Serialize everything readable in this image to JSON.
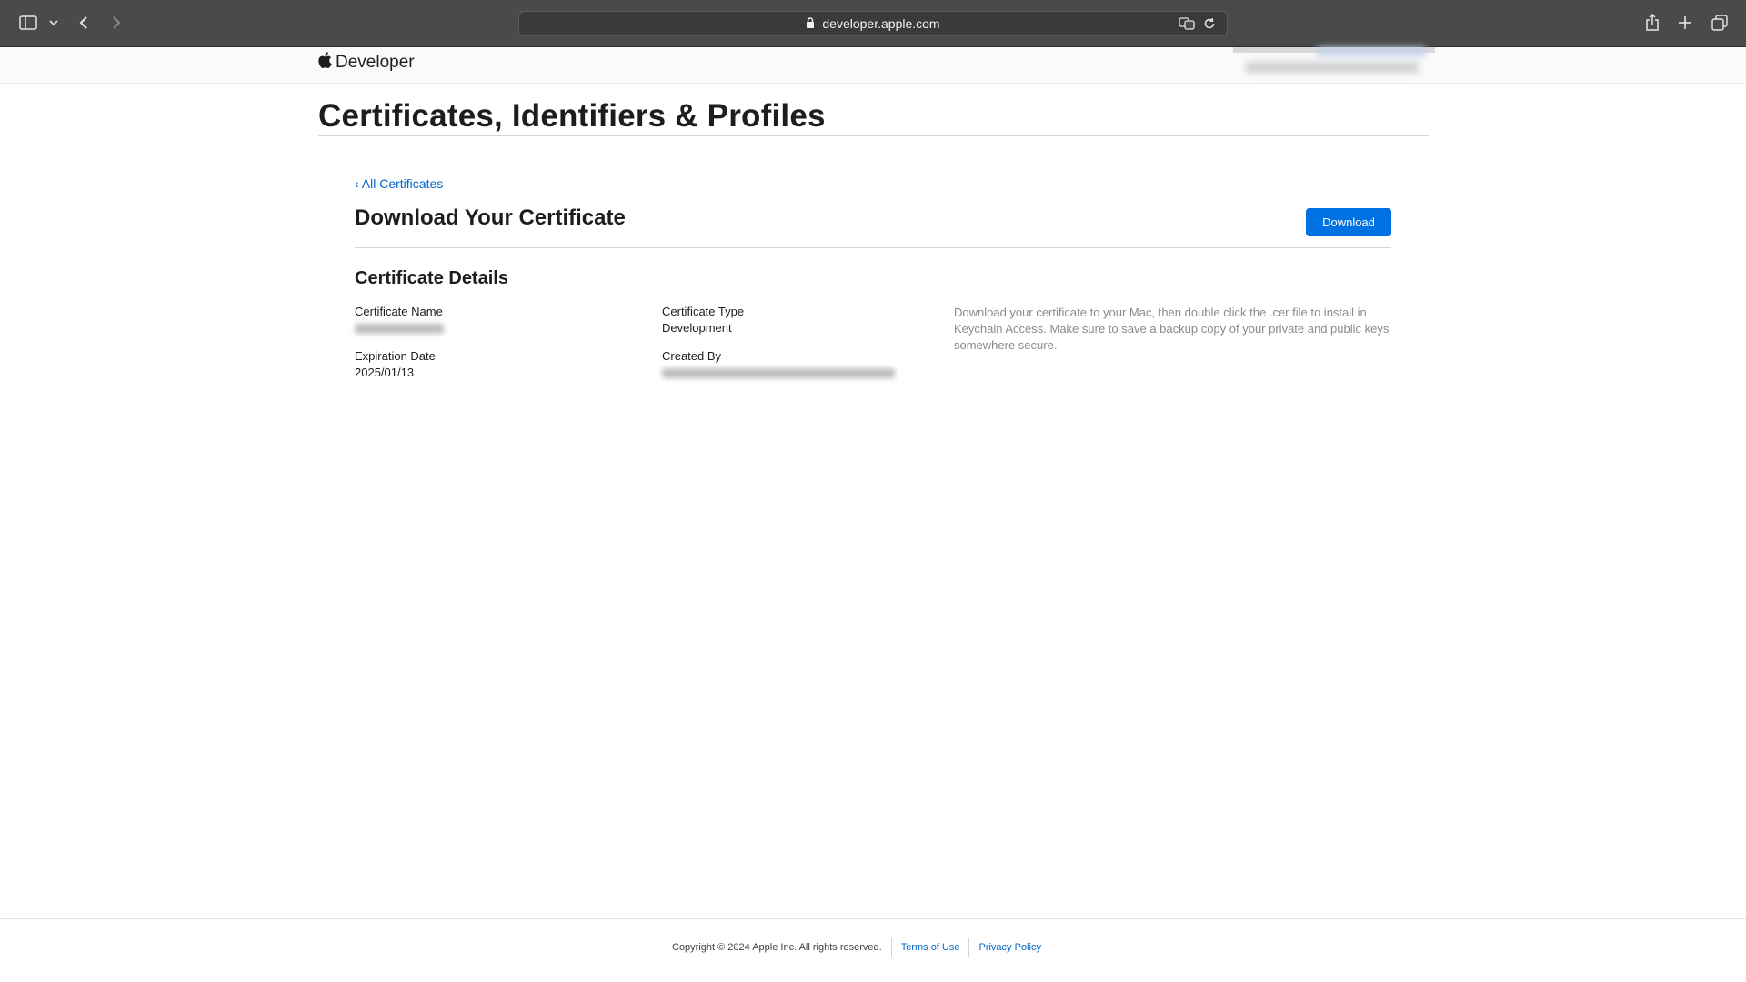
{
  "browser": {
    "url": "developer.apple.com"
  },
  "header": {
    "brand": "Developer"
  },
  "page": {
    "title": "Certificates, Identifiers & Profiles",
    "back_link": "‹ All Certificates",
    "section_title": "Download Your Certificate",
    "download_label": "Download",
    "details_title": "Certificate Details",
    "fields": {
      "name_label": "Certificate Name",
      "type_label": "Certificate Type",
      "type_value": "Development",
      "expiration_label": "Expiration Date",
      "expiration_value": "2025/01/13",
      "created_by_label": "Created By"
    },
    "help_text": "Download your certificate to your Mac, then double click the .cer file to install in Keychain Access. Make sure to save a backup copy of your private and public keys somewhere secure."
  },
  "footer": {
    "copyright": "Copyright © 2024 Apple Inc. All rights reserved.",
    "terms": "Terms of Use",
    "privacy": "Privacy Policy"
  },
  "colors": {
    "accent": "#0071e3",
    "link": "#0066cc"
  }
}
